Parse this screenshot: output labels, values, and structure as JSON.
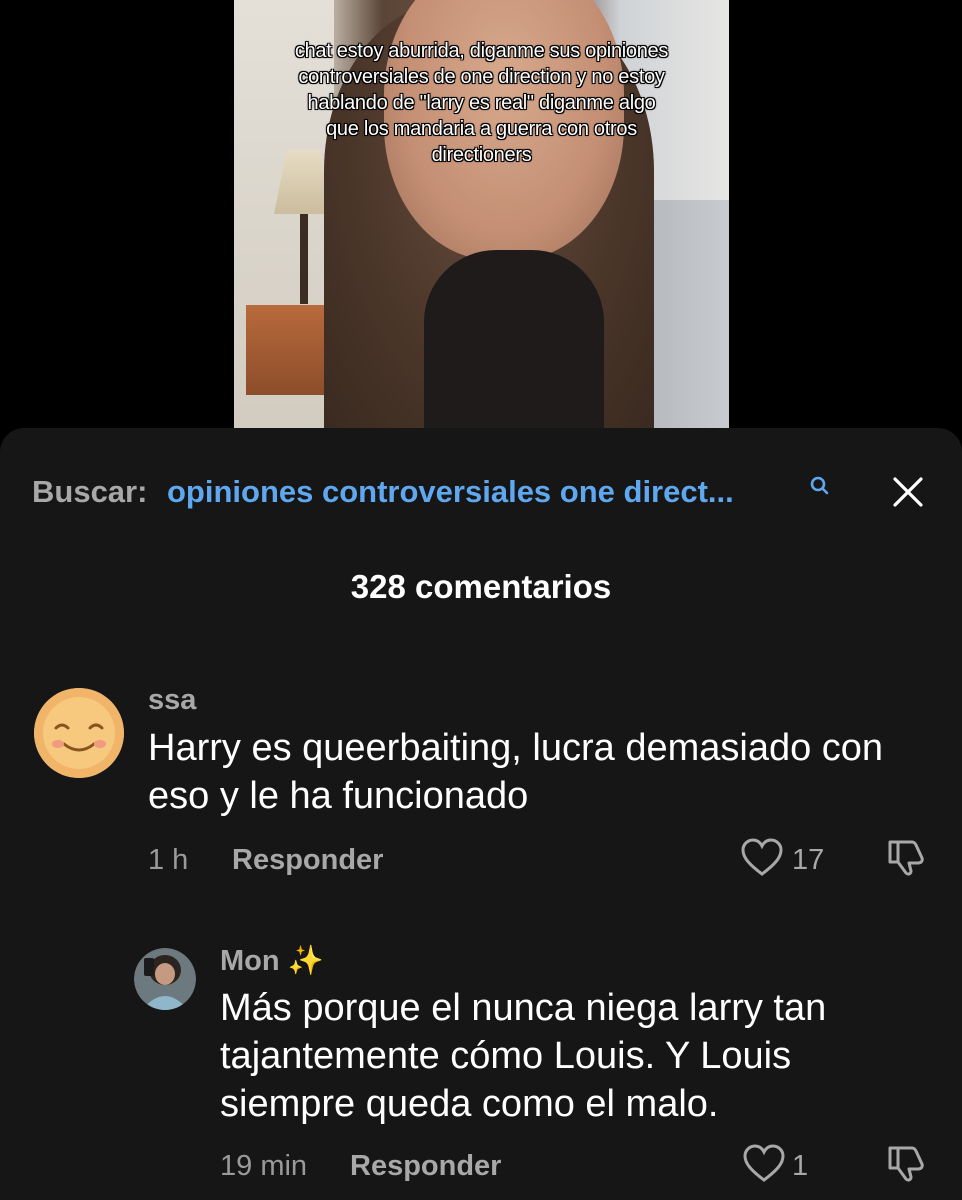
{
  "video": {
    "caption": "chat estoy aburrida, diganme sus opiniones controversiales de one direction y no estoy hablando de \"larry es real\" diganme algo que los mandaria a guerra con otros directioners"
  },
  "search": {
    "prefix": "Buscar:",
    "query": "opiniones controversiales one direct...",
    "icon": "search-icon"
  },
  "header": {
    "comment_count": "328 comentarios",
    "close_icon": "close-icon"
  },
  "comments": [
    {
      "username": "ssa",
      "text": "Harry es queerbaiting, lucra demasiado con eso y le ha funcionado",
      "time": "1 h",
      "reply_label": "Responder",
      "likes": "17",
      "avatar": "smiling-emoji-avatar"
    },
    {
      "username": "Mon ✨",
      "text": "Más porque el nunca niega larry tan tajantemente cómo Louis. Y Louis siempre queda como el malo.",
      "time": "19 min",
      "reply_label": "Responder",
      "likes": "1",
      "avatar": "user-photo-avatar"
    }
  ],
  "colors": {
    "sheet_bg": "#161616",
    "search_query": "#5fa8f0",
    "muted_text": "#a8a8a8"
  }
}
